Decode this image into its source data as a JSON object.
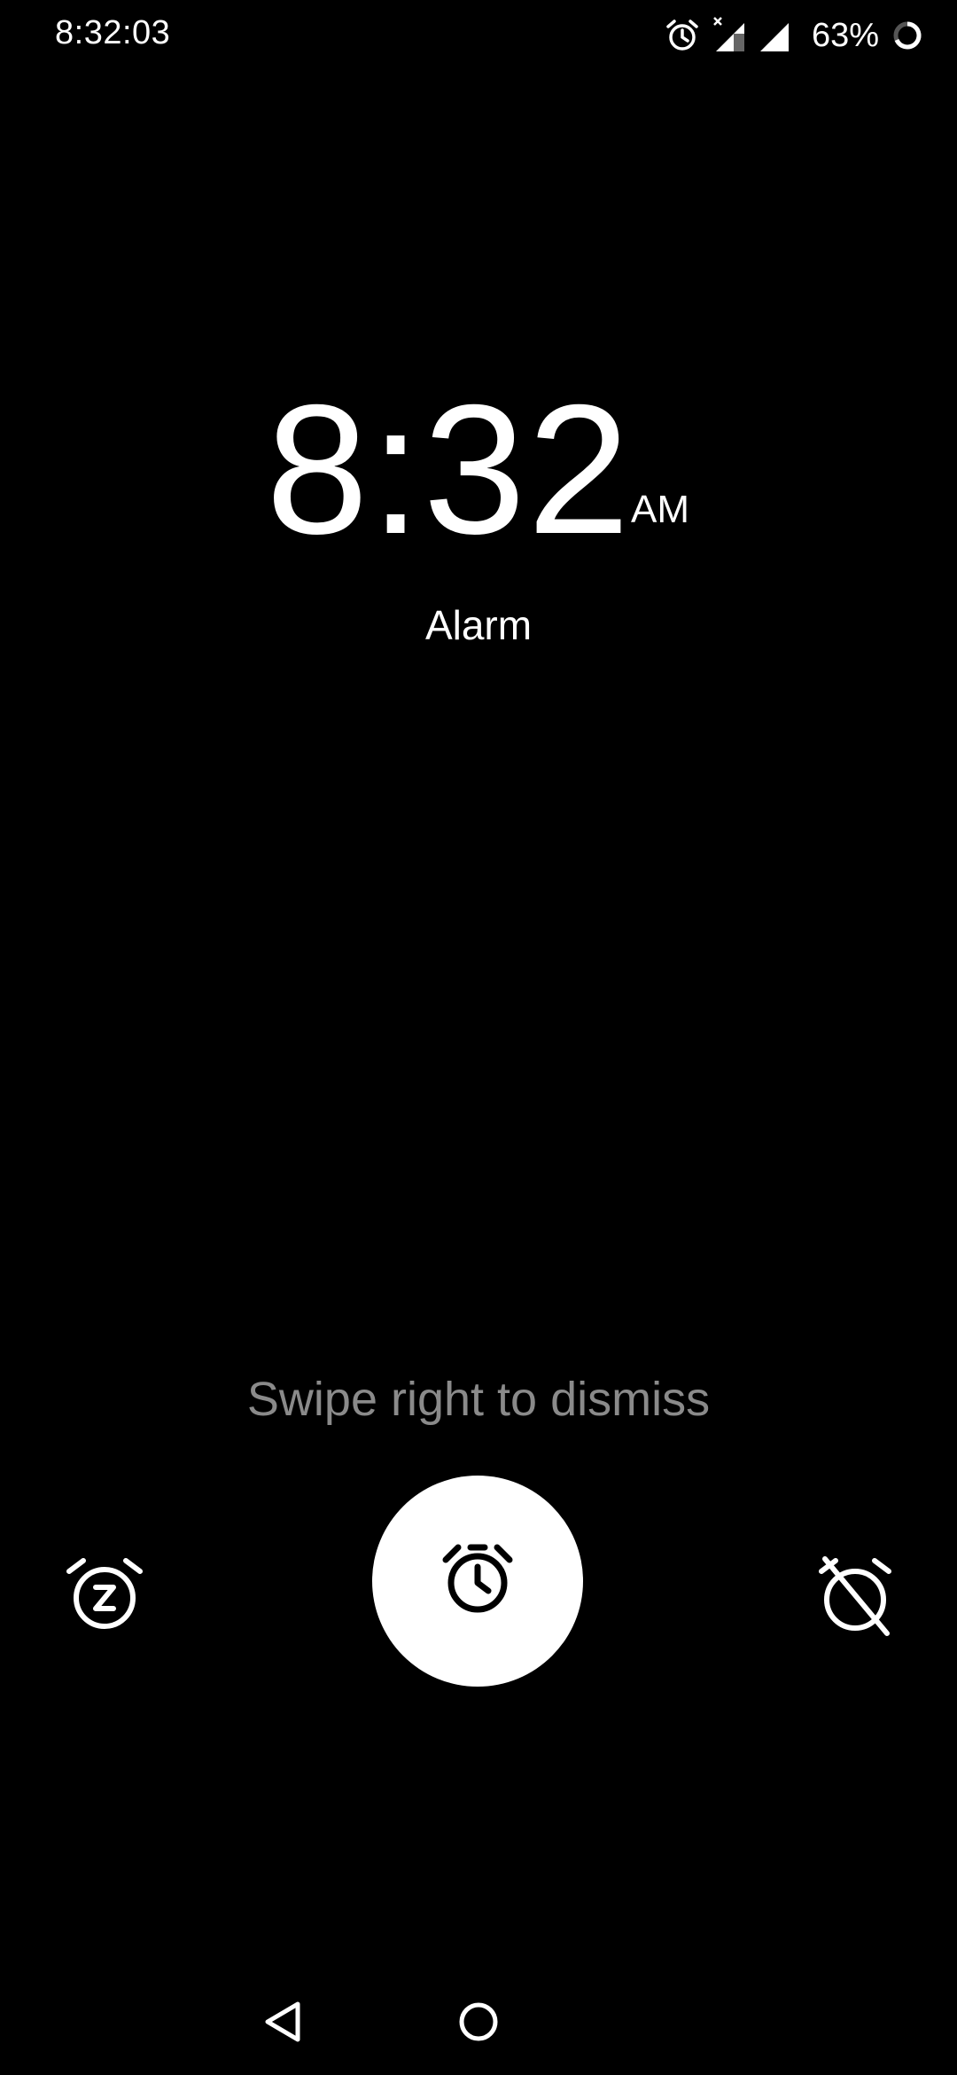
{
  "status_bar": {
    "time": "8:32:03",
    "battery_percent": "63%",
    "icons": [
      "alarm-icon",
      "signal-no-data-icon",
      "signal-icon",
      "battery-charging-ring-icon"
    ]
  },
  "clock": {
    "time": "8:32",
    "ampm": "AM"
  },
  "alarm": {
    "label": "Alarm"
  },
  "dismiss": {
    "hint": "Swipe right to dismiss"
  },
  "actions": {
    "snooze_icon": "snooze-alarm-icon",
    "center_icon": "alarm-clock-icon",
    "dismiss_icon": "alarm-off-icon"
  },
  "nav": {
    "icons": [
      "back-icon",
      "home-icon"
    ]
  },
  "colors": {
    "background": "#000000",
    "foreground": "#ffffff",
    "hint": "#8a8a8a"
  }
}
